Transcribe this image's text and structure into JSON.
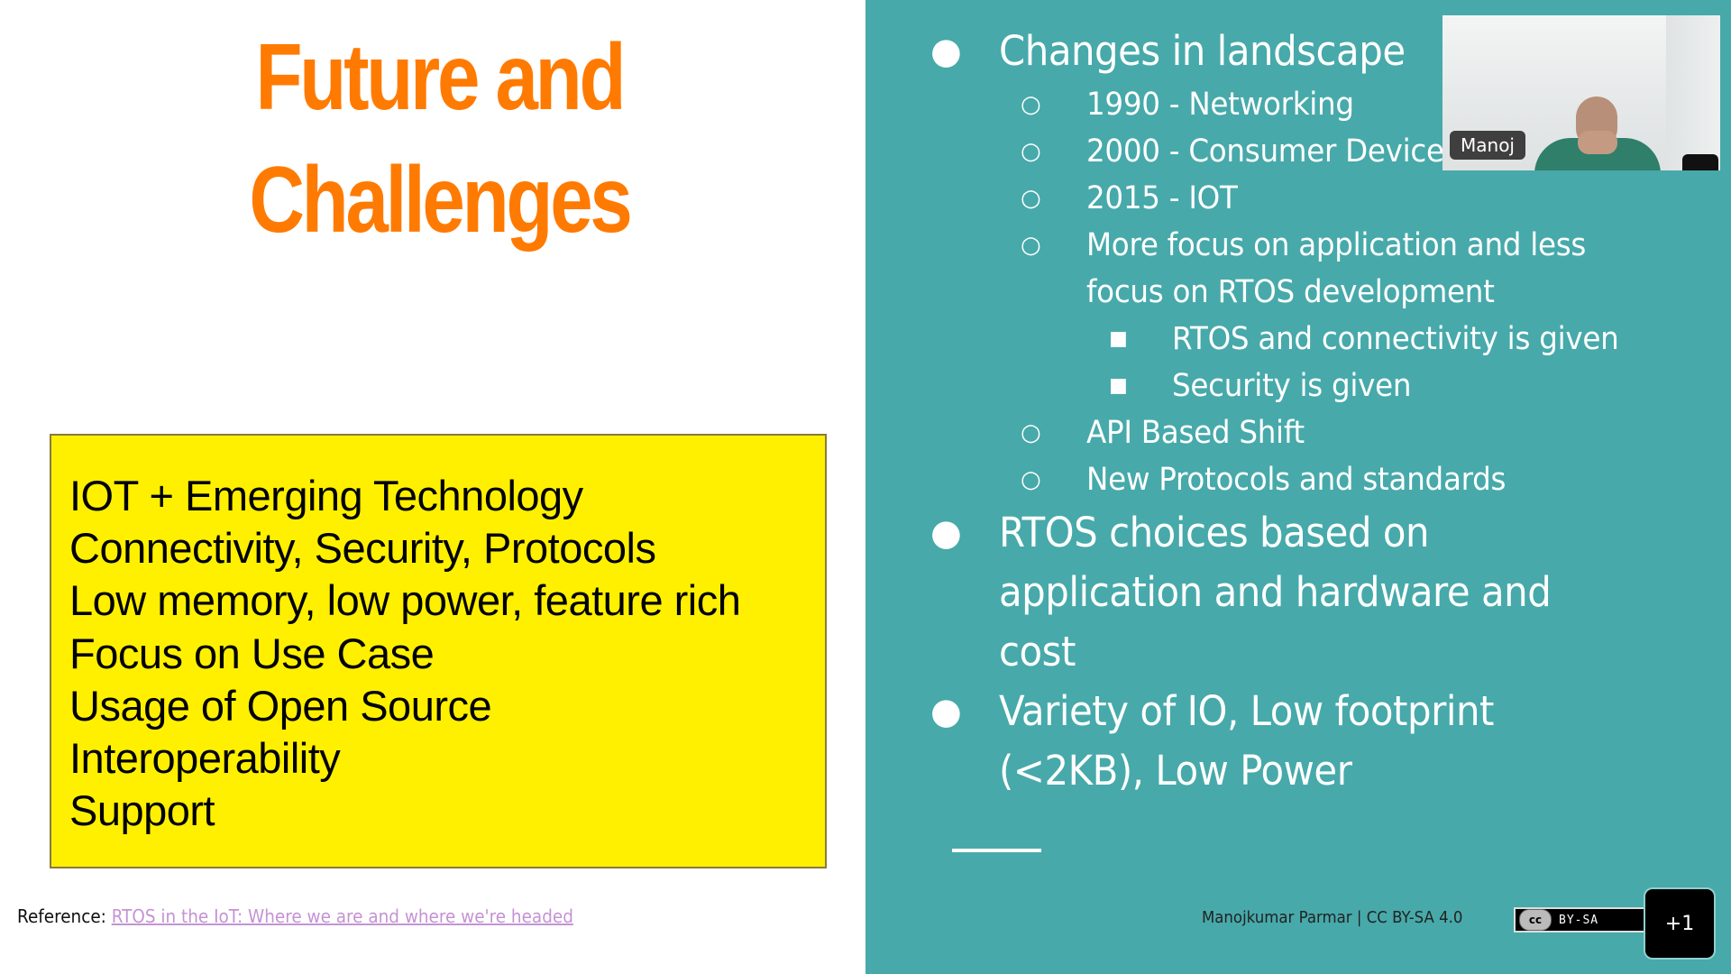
{
  "slide": {
    "title_lines": [
      "Future and",
      "Challenges"
    ],
    "title_color": "#ff7a00",
    "highlight_box": {
      "background": "#fff000",
      "lines": [
        "IOT + Emerging Technology",
        "Connectivity, Security, Protocols",
        "Low memory, low power, feature rich",
        "Focus on Use Case",
        "Usage of Open Source",
        "Interoperability",
        "Support"
      ]
    },
    "reference": {
      "label": "Reference: ",
      "link_text": "RTOS in the IoT: Where we are and where we're headed"
    },
    "right_panel": {
      "background": "#47a9aa",
      "bullets": [
        {
          "level": 1,
          "marker": "●",
          "text": "Changes in landscape"
        },
        {
          "level": 2,
          "marker": "○",
          "text": "1990 - Networking"
        },
        {
          "level": 2,
          "marker": "○",
          "text": "2000 - Consumer Devices"
        },
        {
          "level": 2,
          "marker": "○",
          "text": "2015 - IOT"
        },
        {
          "level": 2,
          "marker": "○",
          "text": "More focus on application and less"
        },
        {
          "level": 2,
          "marker": "",
          "text": "focus on RTOS development"
        },
        {
          "level": 3,
          "marker": "■",
          "text": "RTOS and connectivity is given"
        },
        {
          "level": 3,
          "marker": "■",
          "text": "Security is given"
        },
        {
          "level": 2,
          "marker": "○",
          "text": "API Based Shift"
        },
        {
          "level": 2,
          "marker": "○",
          "text": "New Protocols and standards"
        },
        {
          "level": 1,
          "marker": "●",
          "text": "RTOS choices based on"
        },
        {
          "level": 1,
          "marker": "",
          "text": "application and hardware and"
        },
        {
          "level": 1,
          "marker": "",
          "text": "cost"
        },
        {
          "level": 1,
          "marker": "●",
          "text": "Variety of IO, Low footprint"
        },
        {
          "level": 1,
          "marker": "",
          "text": "(<2KB), Low Power"
        }
      ],
      "attribution": "Manojkumar Parmar | CC BY-SA 4.0",
      "license_badge": {
        "cc": "cc",
        "label": "BY-SA"
      }
    }
  },
  "meeting": {
    "participant_name": "Manoj",
    "overflow_count": "+1"
  }
}
